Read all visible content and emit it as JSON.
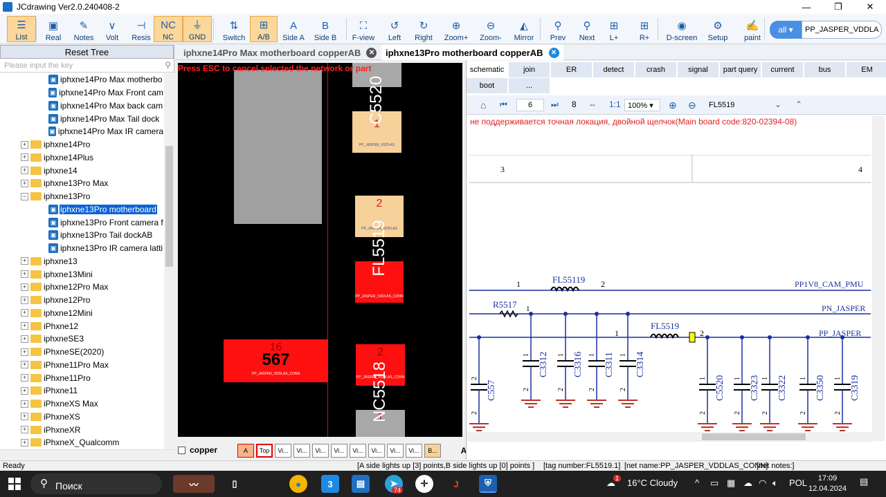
{
  "window": {
    "title": "JCdrawing Ver2.0.240408-2"
  },
  "toolbar": [
    {
      "label": "List",
      "icon": "list-icon",
      "glyph": "☰"
    },
    {
      "label": "Real",
      "icon": "image-icon",
      "glyph": "▣"
    },
    {
      "label": "Notes",
      "icon": "notes-icon",
      "glyph": "✎"
    },
    {
      "label": "Volt",
      "icon": "volt-icon",
      "glyph": "∨"
    },
    {
      "label": "Resis",
      "icon": "resistor-icon",
      "glyph": "⊣"
    },
    {
      "label": "NC",
      "icon": "nc-icon",
      "glyph": "NC"
    },
    {
      "label": "GND",
      "icon": "ground-icon",
      "glyph": "⏚"
    },
    {
      "label": "Switch",
      "icon": "switch-icon",
      "glyph": "⇅"
    },
    {
      "label": "A/B",
      "icon": "ab-icon",
      "glyph": "⊞"
    },
    {
      "label": "Side A",
      "icon": "side-a-icon",
      "glyph": "A"
    },
    {
      "label": "Side B",
      "icon": "side-b-icon",
      "glyph": "B"
    },
    {
      "label": "F-view",
      "icon": "fullview-icon",
      "glyph": "⛶"
    },
    {
      "label": "Left",
      "icon": "rotate-left-icon",
      "glyph": "↺"
    },
    {
      "label": "Right",
      "icon": "rotate-right-icon",
      "glyph": "↻"
    },
    {
      "label": "Zoom+",
      "icon": "zoom-in-icon",
      "glyph": "⊕"
    },
    {
      "label": "Zoom-",
      "icon": "zoom-out-icon",
      "glyph": "⊖"
    },
    {
      "label": "Mirror",
      "icon": "mirror-icon",
      "glyph": "◭"
    },
    {
      "label": "Prev",
      "icon": "prev-icon",
      "glyph": "⚲"
    },
    {
      "label": "Next",
      "icon": "next-icon",
      "glyph": "⚲"
    },
    {
      "label": "L+",
      "icon": "l-plus-icon",
      "glyph": "⊞"
    },
    {
      "label": "R+",
      "icon": "r-plus-icon",
      "glyph": "⊞"
    },
    {
      "label": "D-screen",
      "icon": "dual-screen-icon",
      "glyph": "◉"
    },
    {
      "label": "Setup",
      "icon": "gear-icon",
      "glyph": "⚙"
    },
    {
      "label": "paint",
      "icon": "paint-icon",
      "glyph": "✍"
    }
  ],
  "net_filter": {
    "scope": "all",
    "net": "PP_JASPER_VDDLA"
  },
  "sidebar": {
    "reset_label": "Reset Tree",
    "search_placeholder": "Please input the key",
    "items": [
      {
        "label": "iphxne14Pro Max motherbo",
        "type": "file",
        "level": 2
      },
      {
        "label": "iphxne14Pro Max Front cam",
        "type": "file",
        "level": 2
      },
      {
        "label": "iphxne14Pro Max back cam",
        "type": "file",
        "level": 2
      },
      {
        "label": "iphxne14Pro Max Tail dock",
        "type": "file",
        "level": 2
      },
      {
        "label": "iphxne14Pro Max IR camera",
        "type": "file",
        "level": 2
      },
      {
        "label": "iphxne14Pro",
        "type": "folder",
        "level": 1,
        "exp": "+"
      },
      {
        "label": "iphxne14Plus",
        "type": "folder",
        "level": 1,
        "exp": "+"
      },
      {
        "label": "iphxne14",
        "type": "folder",
        "level": 1,
        "exp": "+"
      },
      {
        "label": "iphxne13Pro Max",
        "type": "folder",
        "level": 1,
        "exp": "+"
      },
      {
        "label": "iphxne13Pro",
        "type": "folder",
        "level": 1,
        "exp": "−"
      },
      {
        "label": "iphxne13Pro motherboard",
        "type": "file",
        "level": 2,
        "selected": true
      },
      {
        "label": "iphxne13Pro Front camera f",
        "type": "file",
        "level": 2
      },
      {
        "label": "iphxne13Pro Tail dockAB",
        "type": "file",
        "level": 2
      },
      {
        "label": "iphxne13Pro IR camera latti",
        "type": "file",
        "level": 2
      },
      {
        "label": "iphxne13",
        "type": "folder",
        "level": 1,
        "exp": "+"
      },
      {
        "label": "iphxne13Mini",
        "type": "folder",
        "level": 1,
        "exp": "+"
      },
      {
        "label": "iphxne12Pro Max",
        "type": "folder",
        "level": 1,
        "exp": "+"
      },
      {
        "label": "iphxne12Pro",
        "type": "folder",
        "level": 1,
        "exp": "+"
      },
      {
        "label": "iphxne12Mini",
        "type": "folder",
        "level": 1,
        "exp": "+"
      },
      {
        "label": "iPhxne12",
        "type": "folder",
        "level": 1,
        "exp": "+"
      },
      {
        "label": "iphxneSE3",
        "type": "folder",
        "level": 1,
        "exp": "+"
      },
      {
        "label": "iPhxneSE(2020)",
        "type": "folder",
        "level": 1,
        "exp": "+"
      },
      {
        "label": "iPhxne11Pro Max",
        "type": "folder",
        "level": 1,
        "exp": "+"
      },
      {
        "label": "iPhxne11Pro",
        "type": "folder",
        "level": 1,
        "exp": "+"
      },
      {
        "label": "iPhxne11",
        "type": "folder",
        "level": 1,
        "exp": "+"
      },
      {
        "label": "iPhxneXS Max",
        "type": "folder",
        "level": 1,
        "exp": "+"
      },
      {
        "label": "iPhxneXS",
        "type": "folder",
        "level": 1,
        "exp": "+"
      },
      {
        "label": "iPhxneXR",
        "type": "folder",
        "level": 1,
        "exp": "+"
      },
      {
        "label": "iPhxneX_Qualcomm",
        "type": "folder",
        "level": 1,
        "exp": "+"
      }
    ]
  },
  "doc_tabs": [
    {
      "label": "iphxne14Pro Max motherboard copperAB",
      "active": false
    },
    {
      "label": "iphxne13Pro motherboard copperAB",
      "active": true
    }
  ],
  "board": {
    "esc_message": "Press ESC to cancel selected the network or part",
    "parts": [
      {
        "ref": "C5520",
        "pin": "1",
        "net": "PP_JASPER_VDDLAS"
      },
      {
        "ref": "FL5519",
        "pin": "2",
        "net": "PP_JASPER_VDDLAS"
      },
      {
        "ref": "567",
        "pin": "16",
        "net": "PP_JASPER_VDDLAS_CONN"
      },
      {
        "ref": "NC5518",
        "pin": "2",
        "net": "PP_JASPER_VDDLAS_CONN",
        "pin2": "1"
      }
    ],
    "fl5519_net2": "PP_JASPER_VDDLAS_CONN",
    "copper_label": "copper",
    "layers": [
      "A",
      "Top",
      "Vi...",
      "Vi...",
      "Vi...",
      "Vi...",
      "Vi...",
      "Vi...",
      "Vi...",
      "Vi...",
      "B...",
      "A"
    ]
  },
  "right_panel": {
    "tabs_row1": [
      "schematic",
      "join",
      "ER",
      "detect",
      "crash",
      "signal",
      "part query",
      "current",
      "bus",
      "EM"
    ],
    "tabs_row2": [
      "boot",
      "..."
    ],
    "page": "6",
    "total_pages": "8",
    "zoom": "100%",
    "find_value": "FL5519",
    "notice": "не поддерживается точная локация, двойной щелчок(Main board code:820-02394-08)",
    "grid_cols": [
      "3",
      "4"
    ],
    "schematic": {
      "nets": [
        "PP1V8_CAM_PMU",
        "PN_JASPER",
        "PP_JASPER"
      ],
      "components": [
        {
          "ref": "FL55119",
          "pins": [
            "1",
            "2"
          ]
        },
        {
          "ref": "R5517",
          "pins": [
            "1"
          ]
        },
        {
          "ref": "FL5519",
          "pins": [
            "1",
            "2"
          ]
        }
      ],
      "caps": [
        "C557",
        "C3312",
        "C3316",
        "C3311",
        "C3314",
        "C5520",
        "C3323",
        "C3322",
        "C3350",
        "C3319"
      ]
    }
  },
  "status": {
    "ready": "Ready",
    "lights": "[A side lights up [3] points,B side lights up [0] points ]",
    "tag": "[tag number:FL5519.1]",
    "net": "[net name:PP_JASPER_VDDLAS_CONN]",
    "notes": "[net notes:]"
  },
  "taskbar": {
    "search_placeholder": "Поиск",
    "weather": "16°C  Cloudy",
    "weather_badge": "1",
    "lang": "POL",
    "time": "17:09",
    "date": "12.04.2024",
    "telegram_badge": "74"
  }
}
